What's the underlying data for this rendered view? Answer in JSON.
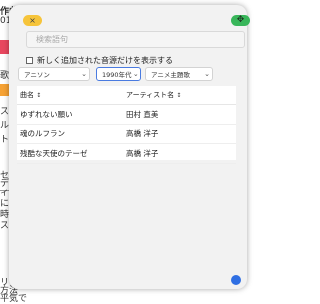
{
  "background": {
    "snippets": [
      "作曲",
      "01",
      "歌",
      "ス",
      "ル",
      "ト",
      "セ",
      "デ",
      "ィスト",
      "に内",
      "時点",
      "スク",
      "リ",
      "方法",
      "平気で"
    ]
  },
  "panel": {
    "close_icon": "×",
    "expand_icon": "✥",
    "search_placeholder": "検索語句",
    "checkbox_label": "新しく追加された音源だけを表示する",
    "filters": [
      {
        "label": "アニソン",
        "chev": "⌄"
      },
      {
        "label": "1990年代",
        "chev": "⌄"
      },
      {
        "label": "アニメ主題歌",
        "chev": "⌄"
      }
    ],
    "table": {
      "col_song": "曲名",
      "col_artist": "アーティスト名",
      "sort_icon": "↕",
      "rows": [
        {
          "song": "ゆずれない願い",
          "artist": "田村 直美"
        },
        {
          "song": "魂のルフラン",
          "artist": "高橋 洋子"
        },
        {
          "song": "残酷な天使のテーゼ",
          "artist": "高橋 洋子"
        }
      ]
    }
  },
  "colors": {
    "close": "#f6c43a",
    "expand": "#38b65a",
    "fab": "#2f6fe3",
    "active_border": "#4a7be0"
  }
}
